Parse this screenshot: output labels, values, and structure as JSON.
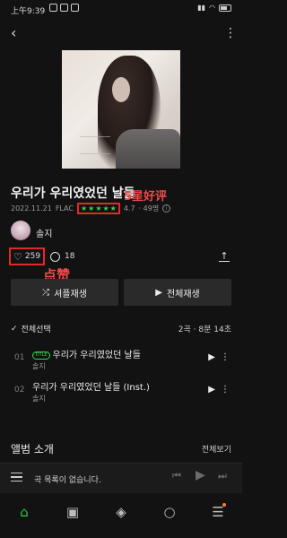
{
  "status_bar": {
    "time": "上午9:39",
    "battery": "93"
  },
  "album": {
    "title": "우리가 우리였었던 날들",
    "date": "2022.11.21",
    "format": "FLAC",
    "rating": "4.7",
    "rating_count": "· 49명",
    "stars": [
      "★",
      "★",
      "★",
      "★",
      "★"
    ],
    "artist": "솔지",
    "likes": "259",
    "comments": "18"
  },
  "annotations": {
    "five_star": "5星好评",
    "like": "点赞"
  },
  "buttons": {
    "shuffle": "셔플재생",
    "play_all": "전체재생"
  },
  "track_list": {
    "select_all": "전체선택",
    "summary": "2곡 · 8분 14초",
    "tracks": [
      {
        "num": "01",
        "badge": "TITLE",
        "title": "우리가 우리였었던 날들",
        "artist": "솔지"
      },
      {
        "num": "02",
        "badge": "",
        "title": "우리가 우리였었던 날들 (Inst.)",
        "artist": "솔지"
      }
    ]
  },
  "album_intro": {
    "title": "앨범 소개",
    "see_all": "전체보기"
  },
  "mini_player": {
    "empty_text": "곡 목록이 없습니다."
  },
  "colors": {
    "accent": "#2ec845",
    "annotation": "#e02a2a",
    "background": "#121212"
  },
  "icons": {
    "back": "chevron-left-icon",
    "more": "more-vertical-icon",
    "heart": "heart-icon",
    "comment": "comment-icon",
    "share": "share-icon",
    "shuffle": "shuffle-icon",
    "play": "play-icon",
    "home": "home-icon",
    "library": "library-icon",
    "layers": "layers-icon",
    "search": "search-icon",
    "locker": "locker-icon"
  }
}
